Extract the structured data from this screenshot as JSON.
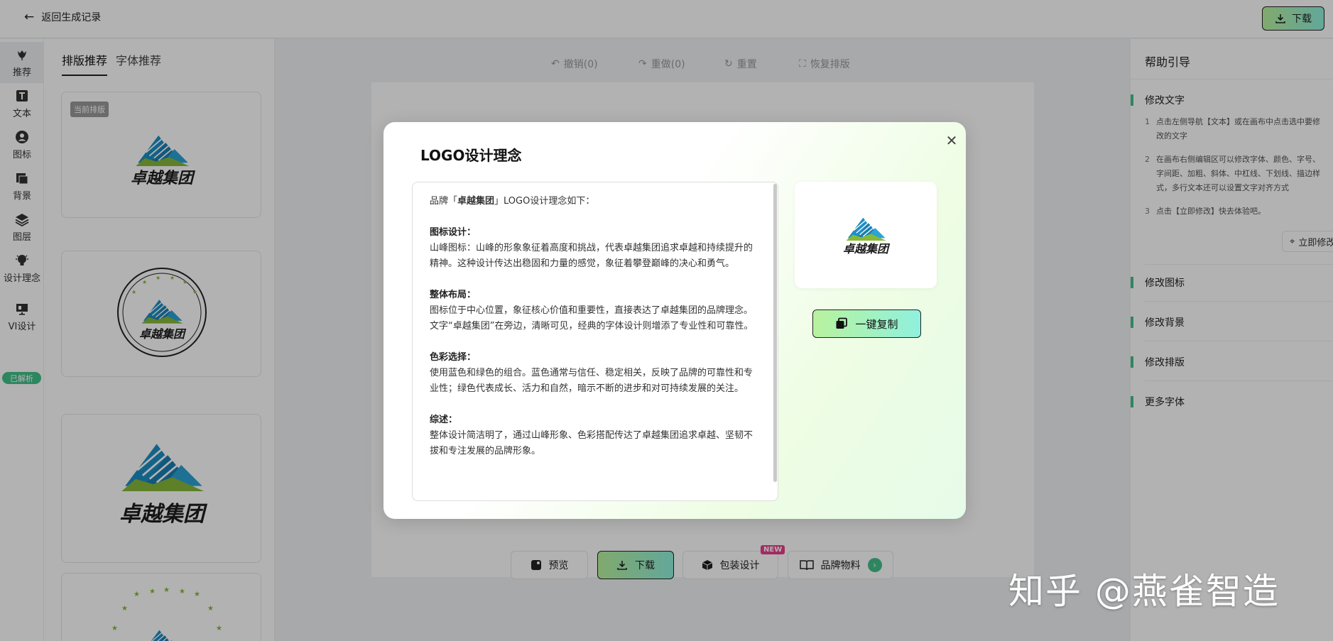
{
  "topbar": {
    "back_label": "返回生成记录",
    "download_label": "下载"
  },
  "nav": {
    "items": [
      {
        "label": "推荐",
        "icon": "tulip-icon"
      },
      {
        "label": "文本",
        "icon": "text-icon"
      },
      {
        "label": "图标",
        "icon": "user-icon"
      },
      {
        "label": "背景",
        "icon": "background-icon"
      },
      {
        "label": "图层",
        "icon": "layers-icon"
      },
      {
        "label": "设计理念",
        "icon": "bulb-icon"
      },
      {
        "label": "VI设计",
        "icon": "vi-icon"
      }
    ],
    "parsed_badge": "已解析"
  },
  "left_panel": {
    "tabs": [
      "排版推荐",
      "字体推荐"
    ],
    "current_tag": "当前排版",
    "brand_name": "卓越集团"
  },
  "toolbar": {
    "undo": "撤销(0)",
    "redo": "重做(0)",
    "reset": "重置",
    "restore": "恢复排版"
  },
  "bottom_bar": {
    "preview": "预览",
    "download": "下载",
    "package": "包装设计",
    "new_badge": "NEW",
    "brand_materials": "品牌物料"
  },
  "help": {
    "title": "帮助引导",
    "sections": [
      "修改文字",
      "修改图标",
      "修改背景",
      "修改排版",
      "更多字体"
    ],
    "steps": [
      {
        "num": "1",
        "lines": [
          "点击左侧导航【文本】或在画布中点击选中要修",
          "改的文字"
        ]
      },
      {
        "num": "2",
        "lines": [
          "在画布右侧编辑区可以修改字体、颜色、字号、",
          "字间距、加粗、斜体、中杠线、下划线、描边样",
          "式，多行文本还可以设置文字对齐方式"
        ]
      },
      {
        "num": "3",
        "lines": [
          "点击【立即修改】快去体验吧。"
        ]
      }
    ],
    "apply_button": "立即修改"
  },
  "modal": {
    "title": "LOGO设计理念",
    "intro_prefix": "品牌「",
    "intro_brand": "卓越集团",
    "intro_suffix": "」LOGO设计理念如下：",
    "sections": [
      {
        "heading": "图标设计：",
        "body": "山峰图标：山峰的形象象征着高度和挑战，代表卓越集团追求卓越和持续提升的精神。这种设计传达出稳固和力量的感觉，象征着攀登巅峰的决心和勇气。"
      },
      {
        "heading": "整体布局：",
        "body": "图标位于中心位置，象征核心价值和重要性，直接表达了卓越集团的品牌理念。文字“卓越集团”在旁边，清晰可见，经典的字体设计则增添了专业性和可靠性。"
      },
      {
        "heading": "色彩选择：",
        "body": "使用蓝色和绿色的组合。蓝色通常与信任、稳定相关，反映了品牌的可靠性和专业性；绿色代表成长、活力和自然，暗示不断的进步和对可持续发展的关注。"
      },
      {
        "heading": "综述：",
        "body": "整体设计简洁明了，通过山峰形象、色彩搭配传达了卓越集团追求卓越、坚韧不拔和专注发展的品牌形象。"
      }
    ],
    "copy_button": "一键复制",
    "brand_name": "卓越集团"
  },
  "watermark": "知乎 @燕雀智造",
  "colors": {
    "accent_green": "#43c08a",
    "logo_blue": "#1c8fc4",
    "logo_green": "#86b83a",
    "button_gradient_start": "#b9f29e",
    "button_gradient_end": "#8ff1dd"
  }
}
